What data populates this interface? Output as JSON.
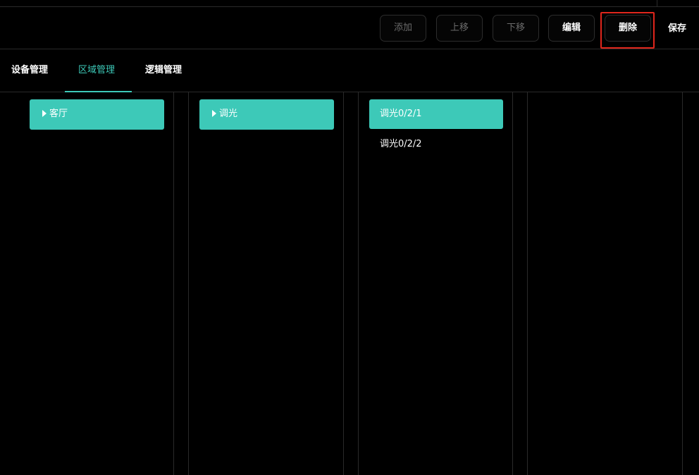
{
  "toolbar": {
    "add_label": "添加",
    "up_label": "上移",
    "down_label": "下移",
    "edit_label": "编辑",
    "delete_label": "删除",
    "save_label": "保存"
  },
  "tabs": [
    {
      "label": "设备管理",
      "selected": false
    },
    {
      "label": "区域管理",
      "selected": true
    },
    {
      "label": "逻辑管理",
      "selected": false
    }
  ],
  "columns": {
    "areas": [
      {
        "label": "客厅",
        "expandable": true,
        "selected": true
      }
    ],
    "groups": [
      {
        "label": "调光",
        "expandable": true,
        "selected": true
      }
    ],
    "channels": [
      {
        "label": "调光0/2/1",
        "selected": true
      },
      {
        "label": "调光0/2/2",
        "selected": false
      }
    ]
  },
  "colors": {
    "accent": "#3dc9b8",
    "background": "#000000",
    "highlight": "#e0261c",
    "disabled_text": "#6b6b6b"
  }
}
